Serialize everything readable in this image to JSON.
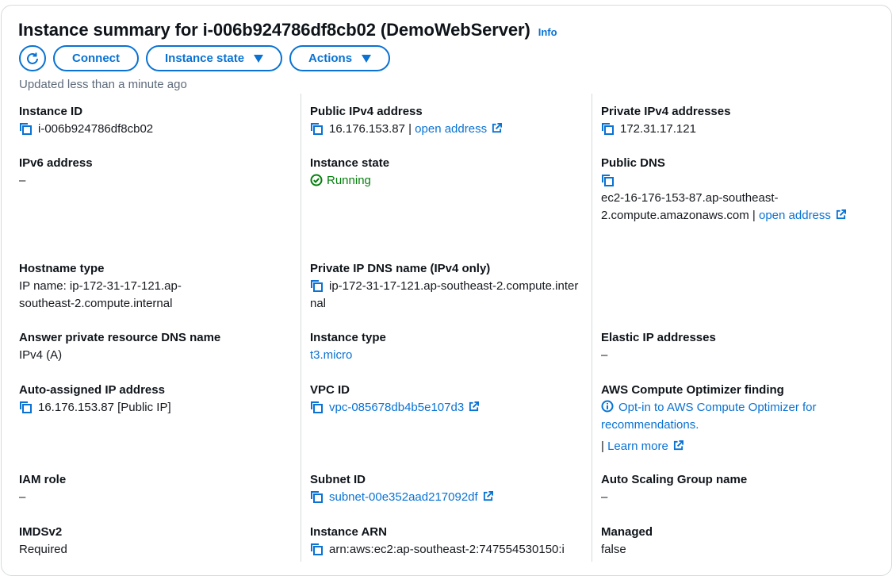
{
  "header": {
    "title": "Instance summary for i-006b924786df8cb02 (DemoWebServer)",
    "info_label": "Info",
    "updated_text": "Updated less than a minute ago"
  },
  "toolbar": {
    "refresh_icon": "refresh-icon",
    "connect_label": "Connect",
    "instance_state_label": "Instance state",
    "actions_label": "Actions"
  },
  "colors": {
    "accent": "#0972d3",
    "running": "#037f0c",
    "border": "#d5dbdb"
  },
  "fields": {
    "instance_id": {
      "label": "Instance ID",
      "value": "i-006b924786df8cb02"
    },
    "public_ipv4": {
      "label": "Public IPv4 address",
      "value": "16.176.153.87 |",
      "link": "open address"
    },
    "private_ipv4": {
      "label": "Private IPv4 addresses",
      "value": "172.31.17.121"
    },
    "ipv6": {
      "label": "IPv6 address",
      "value": "–"
    },
    "instance_state": {
      "label": "Instance state",
      "value": "Running"
    },
    "public_dns": {
      "label": "Public DNS",
      "value": "ec2-16-176-153-87.ap-southeast-2.compute.amazonaws.com |",
      "link": "open address"
    },
    "hostname_type": {
      "label": "Hostname type",
      "value": "IP name: ip-172-31-17-121.ap-southeast-2.compute.internal"
    },
    "private_ip_dns": {
      "label": "Private IP DNS name (IPv4 only)",
      "value": "ip-172-31-17-121.ap-southeast-2.compute.internal"
    },
    "answer_dns": {
      "label": "Answer private resource DNS name",
      "value": "IPv4 (A)"
    },
    "instance_type": {
      "label": "Instance type",
      "value": "t3.micro"
    },
    "elastic_ip": {
      "label": "Elastic IP addresses",
      "value": "–"
    },
    "auto_ip": {
      "label": "Auto-assigned IP address",
      "value": "16.176.153.87 [Public IP]"
    },
    "vpc_id": {
      "label": "VPC ID",
      "value": "vpc-085678db4b5e107d3"
    },
    "optimizer": {
      "label": "AWS Compute Optimizer finding",
      "link": "Opt-in to AWS Compute Optimizer for recommendations.",
      "sep": "|",
      "learn_more": "Learn more"
    },
    "iam_role": {
      "label": "IAM role",
      "value": "–"
    },
    "subnet_id": {
      "label": "Subnet ID",
      "value": "subnet-00e352aad217092df"
    },
    "asg_name": {
      "label": "Auto Scaling Group name",
      "value": "–"
    },
    "imdsv2": {
      "label": "IMDSv2",
      "value": "Required"
    },
    "instance_arn": {
      "label": "Instance ARN",
      "value": "arn:aws:ec2:ap-southeast-2:747554530150:i"
    },
    "managed": {
      "label": "Managed",
      "value": "false"
    }
  }
}
